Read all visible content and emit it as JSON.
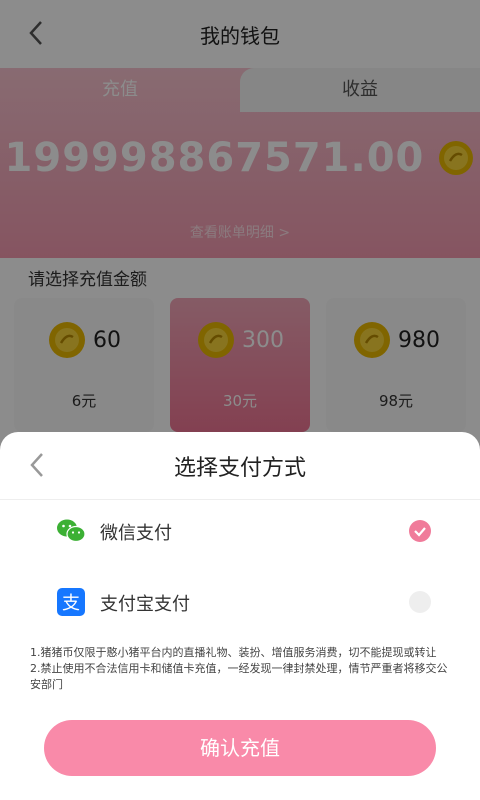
{
  "header": {
    "title": "我的钱包"
  },
  "tabs": [
    {
      "label": "充值"
    },
    {
      "label": "收益"
    }
  ],
  "balance": {
    "amount": "199998867571.00",
    "detail_link": "查看账单明细 >"
  },
  "recharge": {
    "section_label": "请选择充值金额",
    "options": [
      {
        "coins": "60",
        "price": "6元"
      },
      {
        "coins": "300",
        "price": "30元"
      },
      {
        "coins": "980",
        "price": "98元"
      }
    ],
    "selected_index": 1
  },
  "payment_sheet": {
    "title": "选择支付方式",
    "methods": [
      {
        "label": "微信支付",
        "icon": "wechat-icon",
        "selected": true
      },
      {
        "label": "支付宝支付",
        "icon": "alipay-icon",
        "selected": false
      }
    ],
    "notice_lines": [
      "1.猪猪币仅限于憨小猪平台内的直播礼物、装扮、增值服务消费，切不能提现或转让",
      "2.禁止使用不合法信用卡和储值卡充值，一经发现一律封禁处理，情节严重者将移交公安部门"
    ],
    "confirm_label": "确认充值"
  },
  "colors": {
    "accent": "#f07b9a",
    "button": "#f98aa9",
    "header_pink": "#f49ab0",
    "wechat": "#3cb034",
    "alipay": "#1677ff"
  }
}
